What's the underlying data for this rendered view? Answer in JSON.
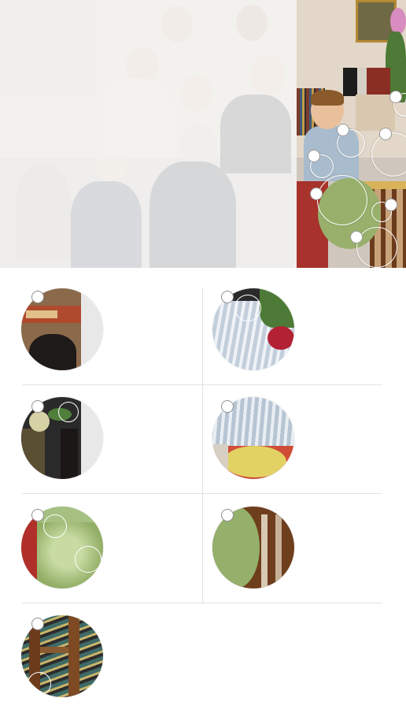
{
  "photo": {
    "description_icon": "photo-icon",
    "hotspots": [
      {
        "name": "hotspot-1"
      },
      {
        "name": "hotspot-2"
      },
      {
        "name": "hotspot-3"
      },
      {
        "name": "hotspot-4"
      },
      {
        "name": "hotspot-5"
      },
      {
        "name": "hotspot-6"
      },
      {
        "name": "hotspot-7"
      },
      {
        "name": "hotspot-8"
      }
    ]
  },
  "thumbnails": [
    {
      "name": "thumb-frame-table"
    },
    {
      "name": "thumb-shirt-rose"
    },
    {
      "name": "thumb-flowers"
    },
    {
      "name": "thumb-shirt-cushion"
    },
    {
      "name": "thumb-green-cushion"
    },
    {
      "name": "thumb-cushion-chair"
    },
    {
      "name": "thumb-chair-rug"
    }
  ],
  "colors": {
    "overlay": "#f4f4f4",
    "divider": "#e3e3e3",
    "dot_fill": "#ffffff",
    "dot_border": "#9a9a9a"
  }
}
